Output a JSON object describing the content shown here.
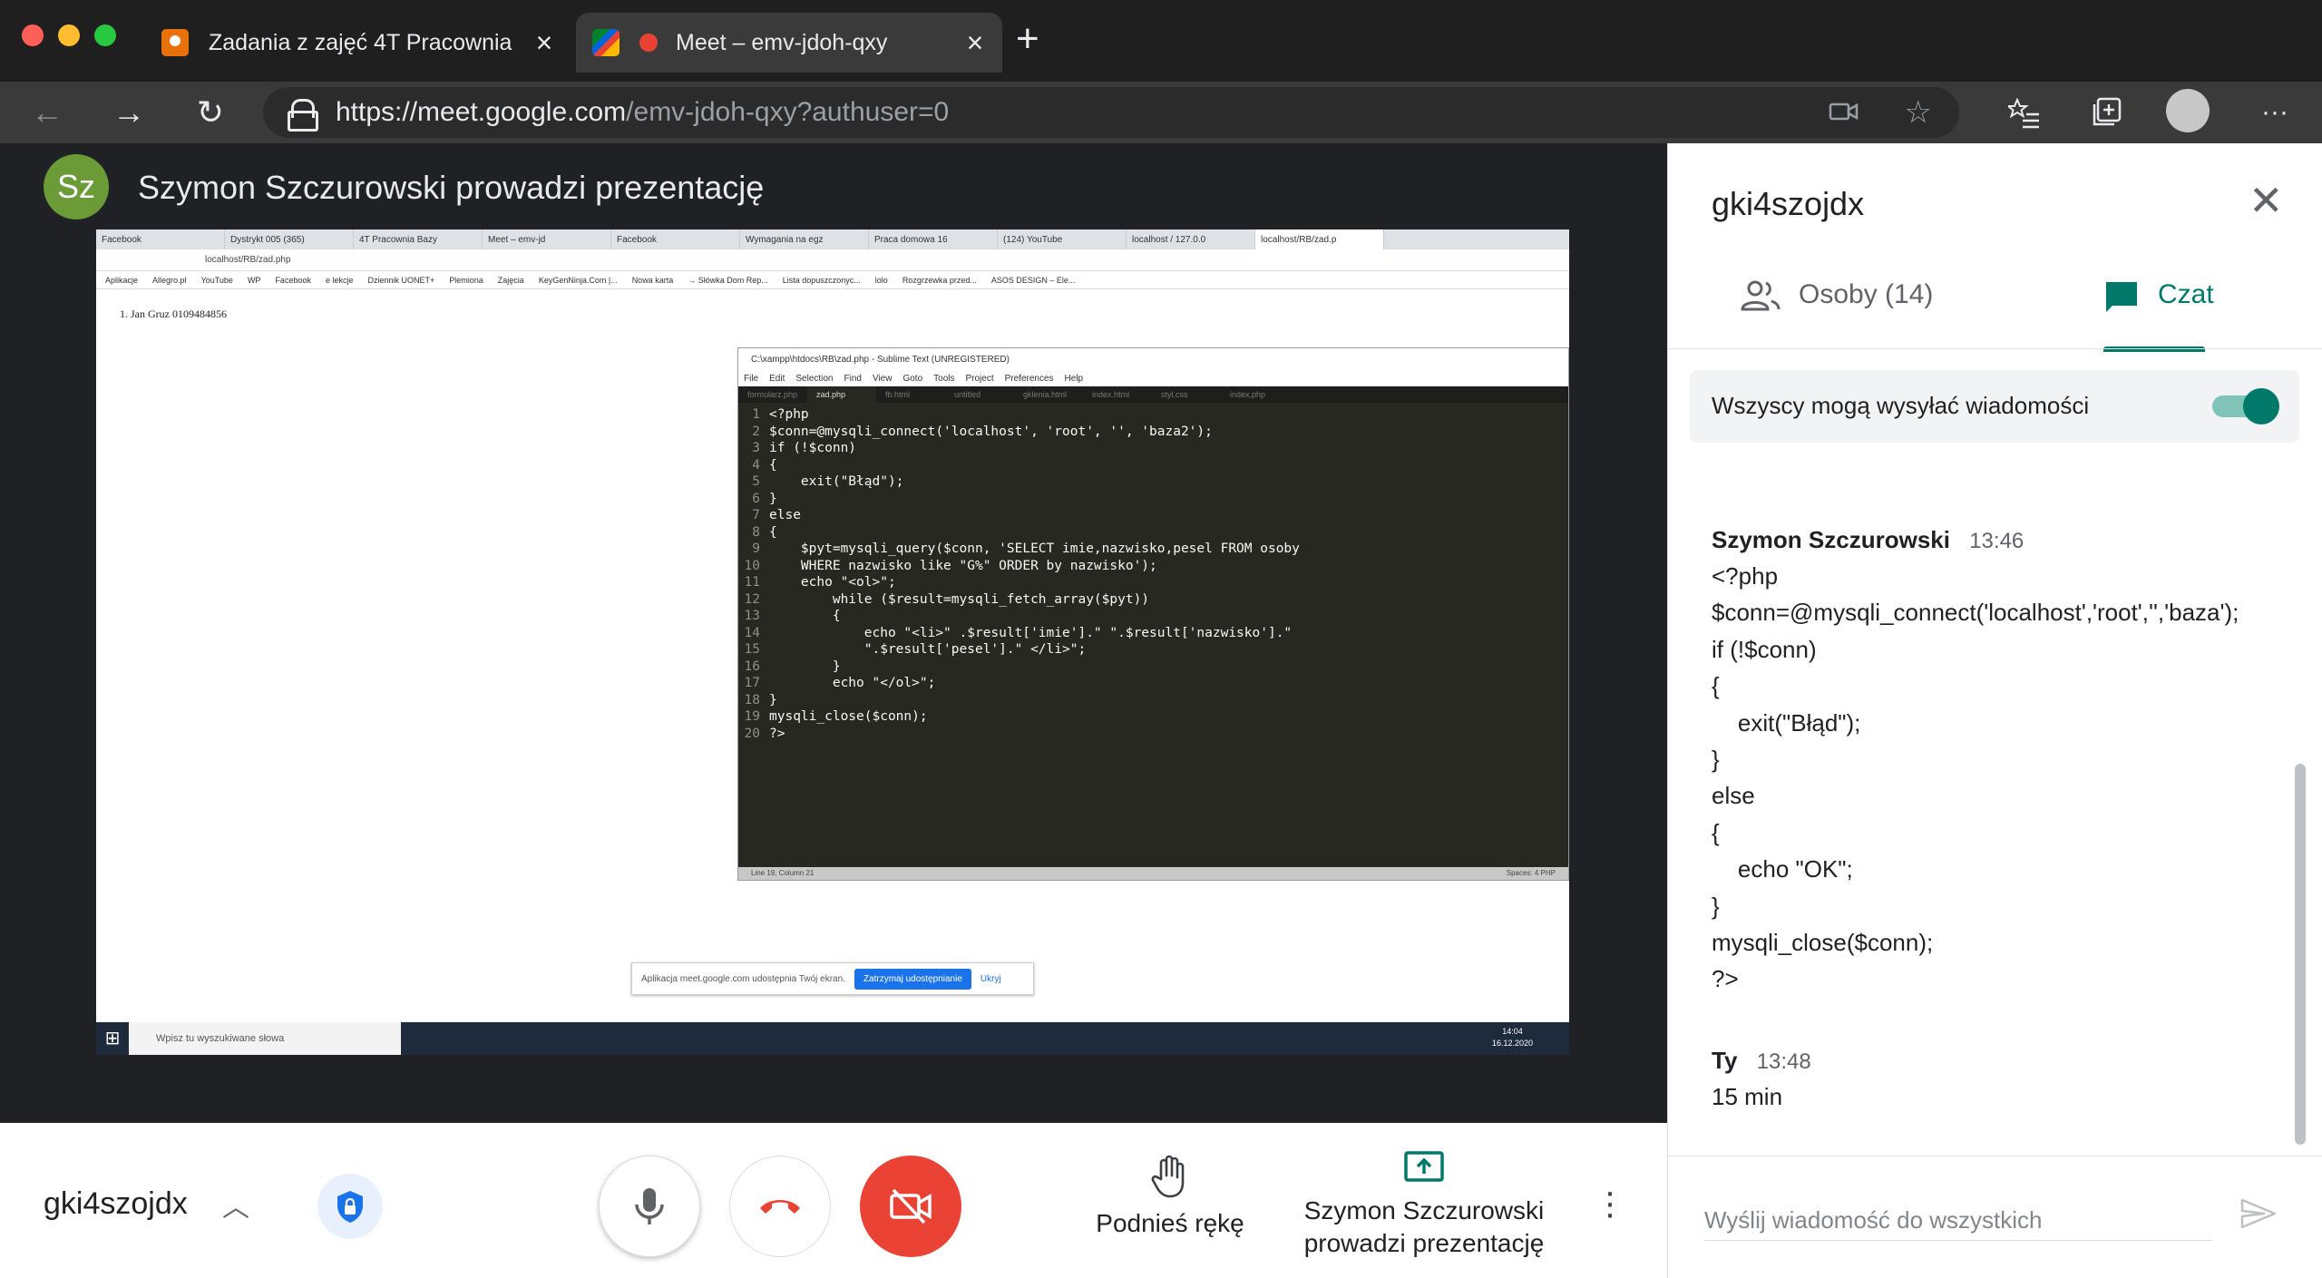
{
  "browser": {
    "tabs": [
      {
        "title": "Zadania z zajęć 4T Pracownia",
        "icon": "classroom-icon"
      },
      {
        "title": "Meet – emv-jdoh-qxy",
        "icon": "meet-icon",
        "recording": true
      }
    ],
    "url_host": "https://meet.google.com",
    "url_rest": "/emv-jdoh-qxy?authuser=0"
  },
  "presenter": {
    "initials": "Sz",
    "banner": "Szymon Szczurowski prowadzi prezentację"
  },
  "shared_screen": {
    "chrome_tabs": [
      "Facebook",
      "Dystrykt 005 (365)",
      "4T Pracownia Bazy",
      "Meet – emv-jd",
      "Facebook",
      "Wymagania na egz",
      "Praca domowa 16",
      "(124) YouTube",
      "localhost / 127.0.0",
      "localhost/RB/zad.p"
    ],
    "address": "localhost/RB/zad.php",
    "bookmarks": [
      "Aplikacje",
      "Allegro.pl",
      "YouTube",
      "WP",
      "Facebook",
      "e lekcje",
      "Dziennik UONET+",
      "Plemiona",
      "Zajęcia",
      "KeyGenNinja.Com |...",
      "Nowa karta",
      "→ Słówka Dom Rep...",
      "Lista dopuszczonyc...",
      "lolo",
      "Rozgrzewka przed...",
      "ASOS DESIGN – Ele..."
    ],
    "page_text": "1. Jan Gruz 0109484856",
    "editor_title": "C:\\xampp\\htdocs\\RB\\zad.php - Sublime Text (UNREGISTERED)",
    "editor_menu": [
      "File",
      "Edit",
      "Selection",
      "Find",
      "View",
      "Goto",
      "Tools",
      "Project",
      "Preferences",
      "Help"
    ],
    "editor_tabs": [
      "formularz.php",
      "zad.php",
      "fb.html",
      "untitled",
      "gklenia.html",
      "index.html",
      "styl.css",
      "index.php"
    ],
    "code_lines": [
      "<?php",
      "$conn=@mysqli_connect('localhost', 'root', '', 'baza2');",
      "if (!$conn)",
      "{",
      "    exit(\"Błąd\");",
      "}",
      "else",
      "{",
      "    $pyt=mysqli_query($conn, 'SELECT imie,nazwisko,pesel FROM osoby",
      "    WHERE nazwisko like \"G%\" ORDER by nazwisko');",
      "    echo \"<ol>\";",
      "        while ($result=mysqli_fetch_array($pyt))",
      "        {",
      "            echo \"<li>\" .$result['imie'].\" \".$result['nazwisko'].\"",
      "            \".$result['pesel'].\" </li>\";",
      "        }",
      "        echo \"</ol>\";",
      "}",
      "mysqli_close($conn);",
      "?>"
    ],
    "editor_status": "Line 19, Column 21",
    "editor_status_right": "Spaces: 4        PHP",
    "share_banner_text": "Aplikacja meet.google.com udostępnia Twój ekran.",
    "share_stop": "Zatrzymaj udostępnianie",
    "share_hide": "Ukryj",
    "taskbar_search": "Wpisz tu wyszukiwane słowa",
    "clock_time": "14:04",
    "clock_date": "16.12.2020"
  },
  "bottom": {
    "meeting_code": "gki4szojdx",
    "raise_hand": "Podnieś rękę",
    "presenting_line1": "Szymon Szczurowski",
    "presenting_line2": "prowadzi prezentację"
  },
  "panel": {
    "title": "gki4szojdx",
    "tab_people": "Osoby (14)",
    "tab_chat": "Czat",
    "allow_label": "Wszyscy mogą wysyłać wiadomości",
    "allow_on": true,
    "messages": [
      {
        "sender": "Szymon Szczurowski",
        "time": "13:46",
        "body": "<?php\n$conn=@mysqli_connect('localhost','root','','baza');\nif (!$conn)\n{\n    exit(\"Błąd\");\n}\nelse\n{\n    echo \"OK\";\n}\nmysqli_close($conn);\n?>"
      },
      {
        "sender": "Ty",
        "time": "13:48",
        "body": "15 min"
      }
    ],
    "input_placeholder": "Wyślij wiadomość do wszystkich"
  },
  "colors": {
    "accent": "#00796b",
    "hangup_red": "#ea4335",
    "avatar_green": "#6b9b37"
  }
}
